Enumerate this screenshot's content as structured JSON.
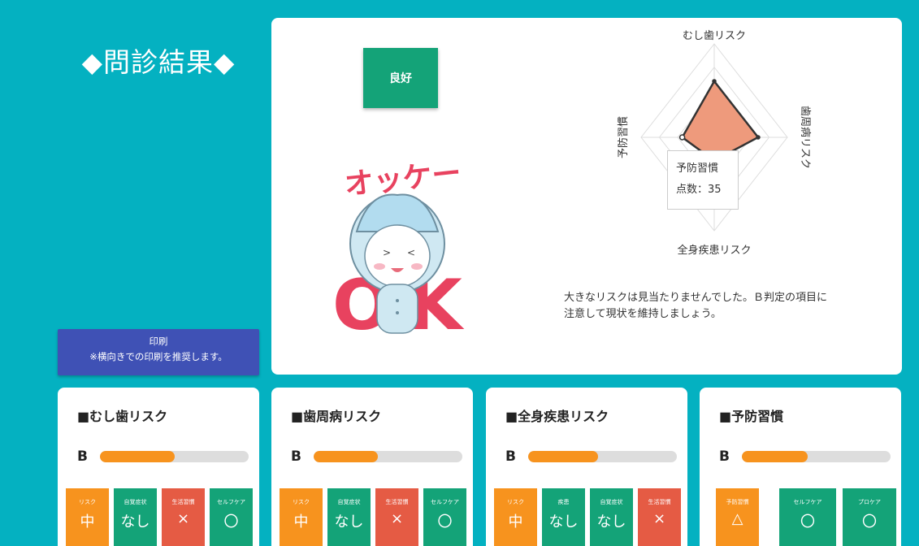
{
  "page": {
    "title": "◆問診結果◆",
    "print_line1": "印刷",
    "print_line2": "※横向きでの印刷を推奨します。"
  },
  "result": {
    "rating": "良好",
    "mascot_text": "オッケー",
    "mascot_ok": "OK",
    "summary_line1": "大きなリスクは見当たりませんでした。Ｂ判定の項目に",
    "summary_line2": "注意して現状を維持しましょう。"
  },
  "radar": {
    "axes": [
      "むし歯リスク",
      "歯周病リスク",
      "全身疾患リスク",
      "予防習慣"
    ],
    "tooltip_title": "予防習慣",
    "tooltip_value": "点数：35"
  },
  "chart_data": {
    "type": "radar",
    "categories": [
      "むし歯リスク",
      "歯周病リスク",
      "全身疾患リスク",
      "予防習慣"
    ],
    "values": [
      48,
      48,
      20,
      35
    ],
    "ylim": [
      0,
      80
    ]
  },
  "cards": [
    {
      "title": "■むし歯リスク",
      "grade": "B",
      "progress": 0.5,
      "tiles": [
        {
          "label": "リスク",
          "value": "中",
          "color": "orange"
        },
        {
          "label": "自覚症状",
          "value": "なし",
          "color": "green"
        },
        {
          "label": "生活習慣",
          "value": "×",
          "color": "red"
        },
        {
          "label": "セルフケア",
          "value": "〇",
          "color": "green"
        }
      ]
    },
    {
      "title": "■歯周病リスク",
      "grade": "B",
      "progress": 0.43,
      "tiles": [
        {
          "label": "リスク",
          "value": "中",
          "color": "orange"
        },
        {
          "label": "自覚症状",
          "value": "なし",
          "color": "green"
        },
        {
          "label": "生活習慣",
          "value": "×",
          "color": "red"
        },
        {
          "label": "セルフケア",
          "value": "〇",
          "color": "green"
        }
      ]
    },
    {
      "title": "■全身疾患リスク",
      "grade": "B",
      "progress": 0.47,
      "tiles": [
        {
          "label": "リスク",
          "value": "中",
          "color": "orange"
        },
        {
          "label": "疾患",
          "value": "なし",
          "color": "green"
        },
        {
          "label": "自覚症状",
          "value": "なし",
          "color": "green"
        },
        {
          "label": "生活習慣",
          "value": "×",
          "color": "red"
        }
      ]
    },
    {
      "title": "■予防習慣",
      "grade": "B",
      "progress": 0.44,
      "tiles": [
        {
          "label": "予防習慣",
          "value": "△",
          "color": "orange"
        },
        {
          "label": "セルフケア",
          "value": "〇",
          "color": "green"
        },
        {
          "label": "プロケア",
          "value": "〇",
          "color": "green"
        }
      ]
    }
  ]
}
